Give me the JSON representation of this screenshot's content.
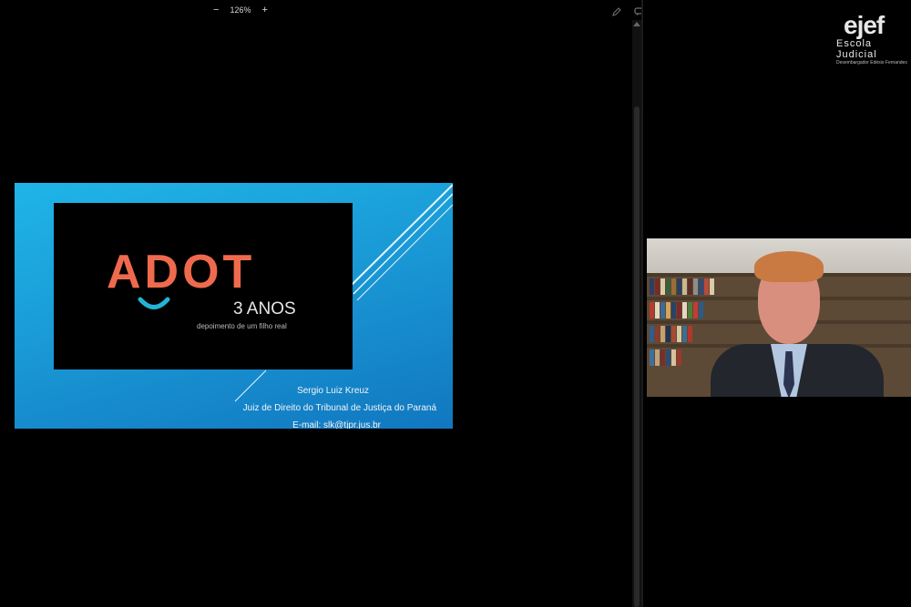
{
  "toolbar": {
    "zoom_out": "−",
    "zoom_level": "126%",
    "zoom_in": "+",
    "icons": [
      "pen-icon",
      "chat-icon"
    ]
  },
  "slide": {
    "logo_text": "ADOT",
    "logo_years": "3 ANOS",
    "logo_subtitle": "depoimento de um filho real",
    "presenter_name": "Sergio Luiz Kreuz",
    "presenter_role": "Juiz de Direito do Tribunal de Justiça do Paraná",
    "presenter_email": "E-mail: slk@tjpr.jus.br",
    "colors": {
      "accent": "#ef6a4d",
      "smile": "#22b4d6",
      "background": "#1a9ad6"
    }
  },
  "watermark": {
    "logo": "ejef",
    "name": "Escola Judicial",
    "subtitle": "Desembargador Edésio Fernandes"
  }
}
